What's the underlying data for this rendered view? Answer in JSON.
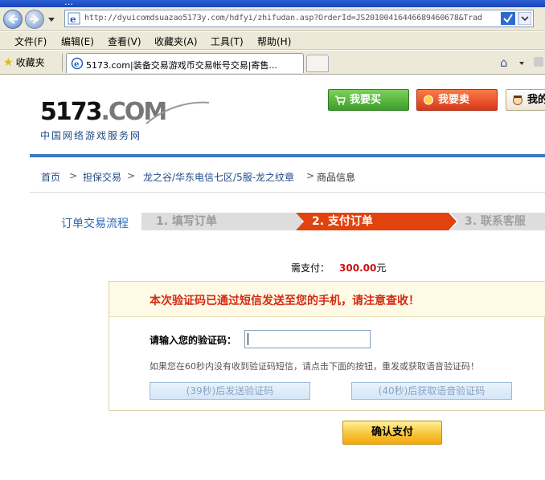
{
  "browser": {
    "title_bar_text": "…",
    "address_url": "http://dyuicomdsuazao5173y.com/hdfyi/zhifudan.asp?OrderId=JS20100416446689460678&Trad",
    "menu": [
      "文件(F)",
      "编辑(E)",
      "查看(V)",
      "收藏夹(A)",
      "工具(T)",
      "帮助(H)"
    ],
    "favorites_label": "收藏夹",
    "tab_title": "5173.com|装备交易游戏币交易帐号交易|寄售..."
  },
  "logo": {
    "text_main": "5173",
    "text_suffix": ".COM",
    "tagline": "中国网络游戏服务网"
  },
  "top_buttons": {
    "buy": "我要买",
    "sell": "我要卖",
    "me": "我的"
  },
  "breadcrumb": {
    "home": "首页",
    "escrow": "担保交易",
    "game_path": "龙之谷/华东电信七区/5服-龙之纹章",
    "current": "商品信息",
    "sep": ">"
  },
  "flow": {
    "label": "订单交易流程",
    "steps": [
      "1. 填写订单",
      "2. 支付订单",
      "3. 联系客服"
    ],
    "active_step": 2
  },
  "payment": {
    "label": "需支付：",
    "amount": "300.00",
    "unit": "元"
  },
  "verify_panel": {
    "notice": "本次验证码已通过短信发送至您的手机，请注意查收！",
    "code_label": "请输入您的验证码：",
    "code_value": "",
    "hint": "如果您在60秒内没有收到验证码短信，请点击下面的按钮，重发或获取语音验证码！",
    "resend_sms_button": "(39秒)后发送验证码",
    "voice_code_button": "(40秒)后获取语音验证码"
  },
  "confirm_button": "确认支付",
  "colors": {
    "active_step": "#e2420e",
    "notice_red": "#d42a13",
    "amount_red": "#d01010",
    "link_blue": "#1f4b86",
    "buy_green": "#3e9d2a",
    "sell_orange": "#d9381a"
  }
}
